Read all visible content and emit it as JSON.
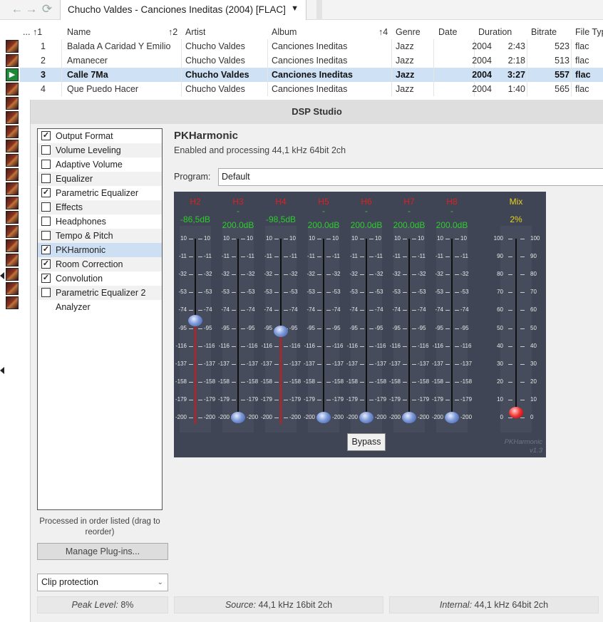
{
  "toolbar": {
    "back_icon": "←",
    "forward_icon": "→",
    "refresh_icon": "⟳"
  },
  "tab": {
    "title": "Chucho Valdes - Canciones Ineditas (2004) [FLAC]",
    "dropdown_icon": "▼"
  },
  "grid": {
    "headers": [
      {
        "key": "num",
        "label": "...",
        "sort": "↑1"
      },
      {
        "key": "name",
        "label": "Name",
        "sort": "↑2"
      },
      {
        "key": "artist",
        "label": "Artist",
        "sort": ""
      },
      {
        "key": "album",
        "label": "Album",
        "sort": "↑4"
      },
      {
        "key": "genre",
        "label": "Genre",
        "sort": ""
      },
      {
        "key": "date",
        "label": "Date",
        "sort": ""
      },
      {
        "key": "duration",
        "label": "Duration",
        "sort": ""
      },
      {
        "key": "bitrate",
        "label": "Bitrate",
        "sort": ""
      },
      {
        "key": "filetype",
        "label": "File Typ",
        "sort": ""
      }
    ],
    "rows": [
      {
        "num": "1",
        "name": "Balada A Caridad Y Emilio",
        "artist": "Chucho Valdes",
        "album": "Canciones Ineditas",
        "genre": "Jazz",
        "date": "2004",
        "duration": "2:43",
        "bitrate": "523",
        "filetype": "flac",
        "playing": false
      },
      {
        "num": "2",
        "name": "Amanecer",
        "artist": "Chucho Valdes",
        "album": "Canciones Ineditas",
        "genre": "Jazz",
        "date": "2004",
        "duration": "2:18",
        "bitrate": "513",
        "filetype": "flac",
        "playing": false
      },
      {
        "num": "3",
        "name": "Calle 7Ma",
        "artist": "Chucho Valdes",
        "album": "Canciones Ineditas",
        "genre": "Jazz",
        "date": "2004",
        "duration": "3:27",
        "bitrate": "557",
        "filetype": "flac",
        "playing": true
      },
      {
        "num": "4",
        "name": "Que Puedo Hacer",
        "artist": "Chucho Valdes",
        "album": "Canciones Ineditas",
        "genre": "Jazz",
        "date": "2004",
        "duration": "1:40",
        "bitrate": "565",
        "filetype": "flac",
        "playing": false
      }
    ]
  },
  "dsp": {
    "title": "DSP Studio",
    "plugins": [
      {
        "label": "Output Format",
        "checked": true,
        "selected": false,
        "has_checkbox": true
      },
      {
        "label": "Volume Leveling",
        "checked": false,
        "selected": false,
        "has_checkbox": true
      },
      {
        "label": "Adaptive Volume",
        "checked": false,
        "selected": false,
        "has_checkbox": true
      },
      {
        "label": "Equalizer",
        "checked": false,
        "selected": false,
        "has_checkbox": true
      },
      {
        "label": "Parametric Equalizer",
        "checked": true,
        "selected": false,
        "has_checkbox": true
      },
      {
        "label": "Effects",
        "checked": false,
        "selected": false,
        "has_checkbox": true
      },
      {
        "label": "Headphones",
        "checked": false,
        "selected": false,
        "has_checkbox": true
      },
      {
        "label": "Tempo & Pitch",
        "checked": false,
        "selected": false,
        "has_checkbox": true
      },
      {
        "label": "PKHarmonic",
        "checked": true,
        "selected": true,
        "has_checkbox": true
      },
      {
        "label": "Room Correction",
        "checked": true,
        "selected": false,
        "has_checkbox": true
      },
      {
        "label": "Convolution",
        "checked": true,
        "selected": false,
        "has_checkbox": true
      },
      {
        "label": "Parametric Equalizer 2",
        "checked": false,
        "selected": false,
        "has_checkbox": true
      },
      {
        "label": "Analyzer",
        "checked": false,
        "selected": false,
        "has_checkbox": false
      }
    ],
    "order_hint": "Processed in order listed (drag to reorder)",
    "manage_label": "Manage Plug-ins...",
    "clip_label": "Clip protection",
    "select_arrow": "⌄",
    "status": {
      "peak_prefix": "Peak Level:",
      "peak_value": "8%",
      "source_prefix": "Source:",
      "source_value": "44,1 kHz 16bit 2ch",
      "internal_prefix": "Internal:",
      "internal_value": "44,1 kHz 64bit 2ch"
    },
    "plugin_title": "PKHarmonic",
    "plugin_status": "Enabled and processing 44,1 kHz 64bit 2ch",
    "program_label": "Program:",
    "program_value": "Default",
    "pk": {
      "ticks": [
        "10",
        "-11",
        "-32",
        "-53",
        "-74",
        "-95",
        "-116",
        "-137",
        "-158",
        "-179",
        "-200"
      ],
      "mix_ticks_left": [
        "100",
        "90",
        "80",
        "70",
        "60",
        "50",
        "40",
        "30",
        "20",
        "10",
        "0"
      ],
      "mix_ticks_right": [
        "100",
        "90",
        "80",
        "70",
        "60",
        "50",
        "40",
        "30",
        "20",
        "10",
        "0"
      ],
      "range": [
        -200,
        10
      ],
      "harmonics": [
        {
          "label": "H2",
          "value_text": "-86,5dB",
          "dash": "",
          "value": -86.5,
          "active": true
        },
        {
          "label": "H3",
          "value_text": "200.0dB",
          "dash": "-",
          "value": -200,
          "active": false
        },
        {
          "label": "H4",
          "value_text": "-98,5dB",
          "dash": "",
          "value": -98.5,
          "active": true
        },
        {
          "label": "H5",
          "value_text": "200.0dB",
          "dash": "-",
          "value": -200,
          "active": false
        },
        {
          "label": "H6",
          "value_text": "200.0dB",
          "dash": "-",
          "value": -200,
          "active": false
        },
        {
          "label": "H7",
          "value_text": "200.0dB",
          "dash": "-",
          "value": -200,
          "active": false
        },
        {
          "label": "H8",
          "value_text": "200.0dB",
          "dash": "-",
          "value": -200,
          "active": false
        }
      ],
      "mix": {
        "label": "Mix",
        "value_text": "2%",
        "value": 2
      },
      "bypass_label": "Bypass",
      "watermark": "PKHarmonic",
      "watermark_version": "v1.3",
      "colors": {
        "harmonic_label": "#e02020",
        "value_text": "#2ecc2e",
        "mix_text": "#e8d020",
        "background": "#3f4554"
      }
    }
  }
}
